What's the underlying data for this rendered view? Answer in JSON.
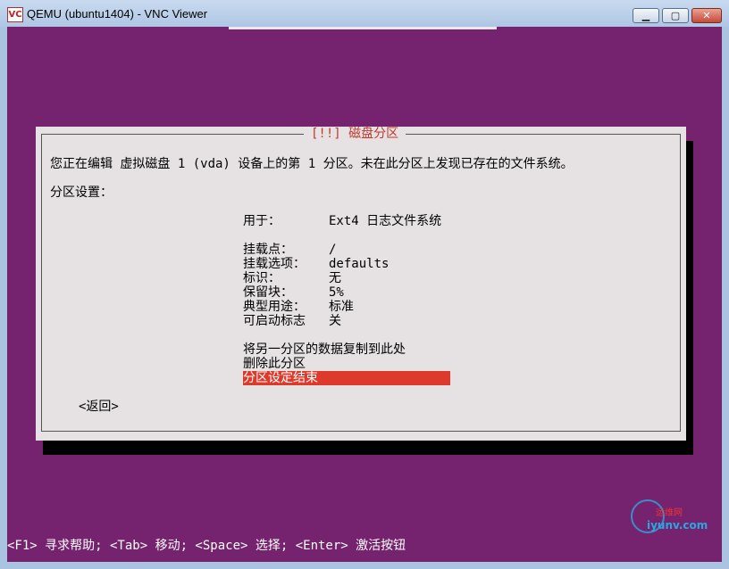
{
  "window": {
    "title": "QEMU (ubuntu1404) - VNC Viewer",
    "icon_label": "VC",
    "minimize_label": "▁",
    "maximize_label": "▢",
    "close_label": "✕"
  },
  "dialog": {
    "title": "[!!] 磁盘分区",
    "intro": "您正在编辑 虚拟磁盘 1 (vda) 设备上的第 1 分区。未在此分区上发现已存在的文件系统。",
    "section_label": "分区设置：",
    "settings": [
      {
        "label": "用于：",
        "value": "Ext4 日志文件系统"
      },
      {
        "label": "挂载点：",
        "value": "/"
      },
      {
        "label": "挂载选项：",
        "value": "defaults"
      },
      {
        "label": "标识：",
        "value": "无"
      },
      {
        "label": "保留块：",
        "value": "5%"
      },
      {
        "label": "典型用途：",
        "value": "标准"
      },
      {
        "label": "可启动标志",
        "value": "关"
      }
    ],
    "actions": [
      "将另一分区的数据复制到此处",
      "删除此分区",
      "分区设定结束"
    ],
    "back_label": "<返回>"
  },
  "statusbar": {
    "text": "<F1> 寻求帮助; <Tab> 移动; <Space> 选择; <Enter> 激活按钮"
  },
  "watermark": {
    "text": "运维网",
    "url": "iyunv.com"
  },
  "colors": {
    "background": "#75236e",
    "dialog": "#e6e2e4",
    "highlight": "#de3a2c",
    "title_text": "#c0392b"
  }
}
